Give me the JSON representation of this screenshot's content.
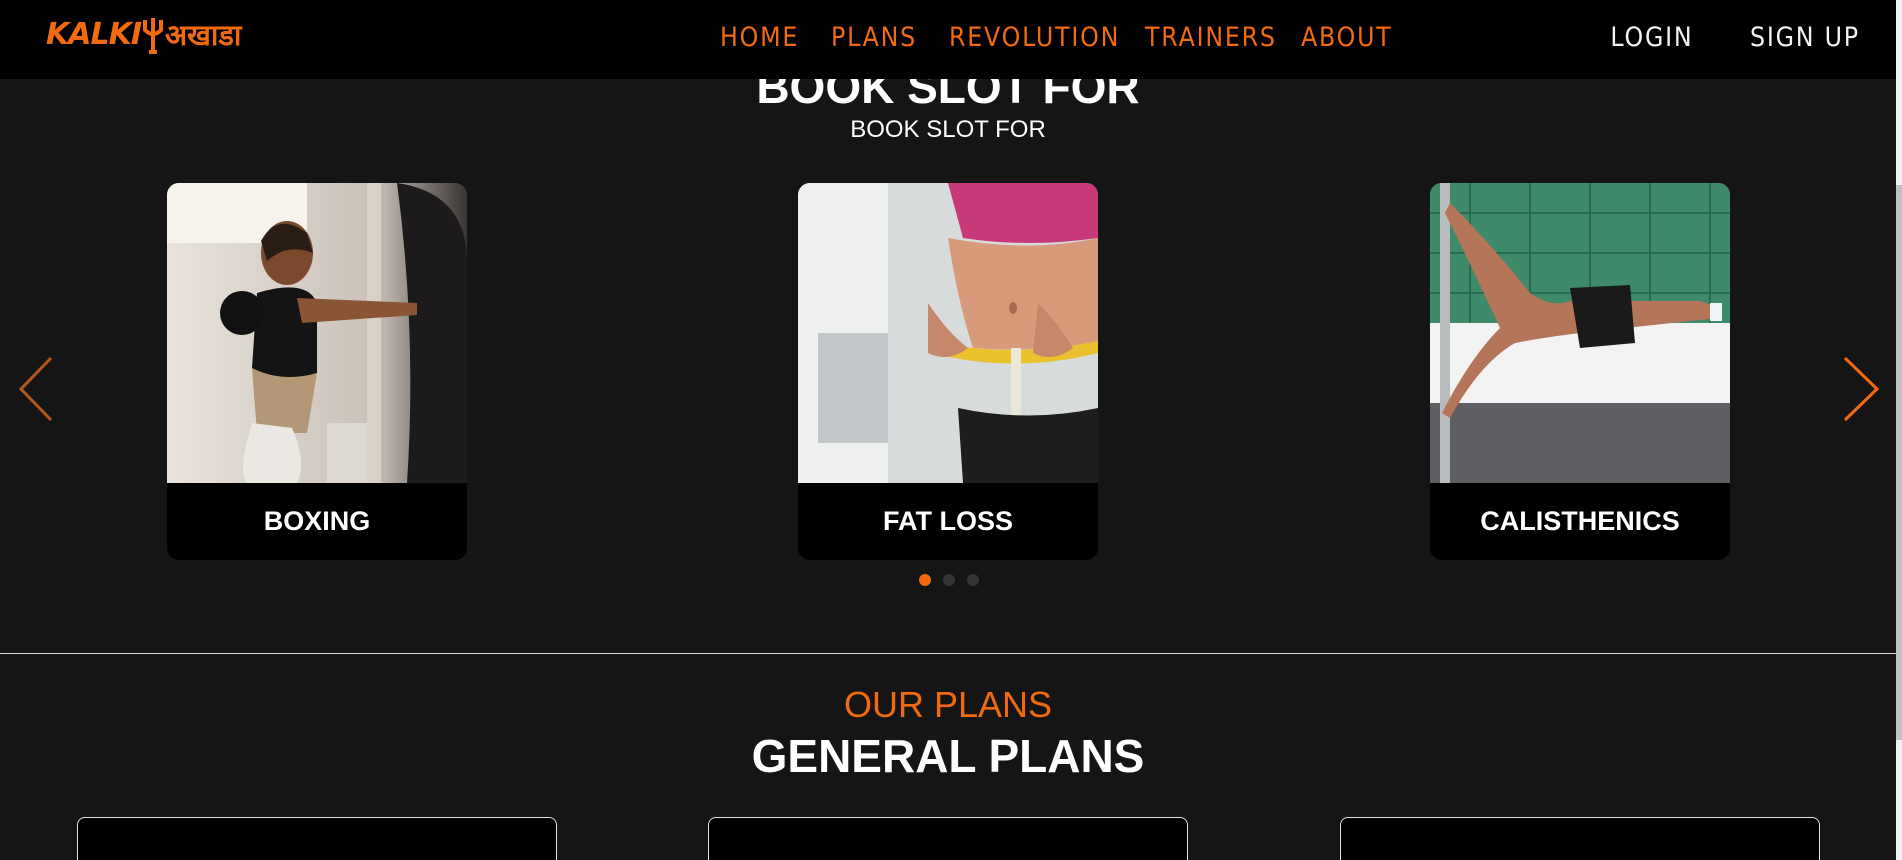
{
  "nav": {
    "logo_latin": "KALKI",
    "logo_devanagari": "अखाडा",
    "links": [
      "HOME",
      "PLANS",
      "REVOLUTION",
      "TRAINERS",
      "ABOUT"
    ],
    "login": "LOGIN",
    "signup": "SIGN UP"
  },
  "slots": {
    "title": "BOOK SLOT FOR",
    "subtitle": "BOOK SLOT FOR",
    "cards": [
      {
        "label": "BOXING"
      },
      {
        "label": "FAT LOSS"
      },
      {
        "label": "CALISTHENICS"
      }
    ],
    "dots_total": 3,
    "dots_active": 1
  },
  "plans": {
    "eyebrow": "OUR PLANS",
    "title": "GENERAL PLANS"
  },
  "colors": {
    "accent": "#f26a10",
    "background": "#151515",
    "navbar": "#000000",
    "text": "#ffffff"
  }
}
